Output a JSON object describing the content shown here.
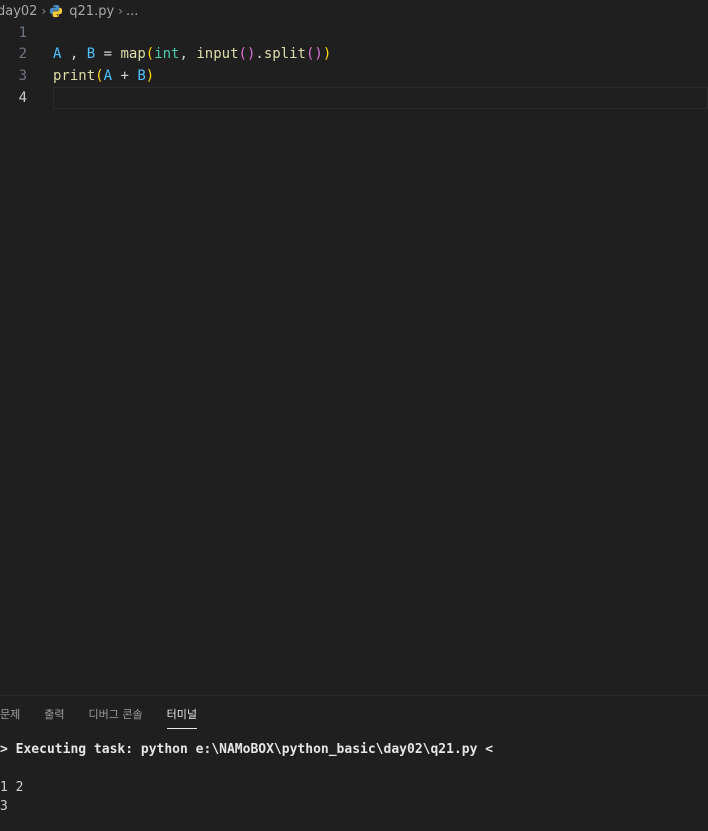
{
  "breadcrumb": {
    "folder": "day02",
    "file": "q21.py",
    "more": "..."
  },
  "editor": {
    "line_numbers": [
      "1",
      "2",
      "3",
      "4"
    ],
    "active_line": "4",
    "line2": {
      "t1": "A",
      "t2": " , ",
      "t3": "B",
      "t4": " = ",
      "t5": "map",
      "t6": "(",
      "t7": "int",
      "t8": ", ",
      "t9": "input",
      "t10": "()",
      "t11": ".",
      "t12": "split",
      "t13": "()",
      "t14": ")"
    },
    "line3": {
      "t1": "print",
      "t2": "(",
      "t3": "A",
      "t4": " + ",
      "t5": "B",
      "t6": ")"
    }
  },
  "panel": {
    "tabs": [
      "문제",
      "출력",
      "디버그 콘솔",
      "터미널"
    ],
    "active_tab": "터미널"
  },
  "terminal": {
    "task_line": "> Executing task: python e:\\NAMoBOX\\python_basic\\day02\\q21.py <",
    "blank": "",
    "input_line": "1 2",
    "output_line": "3"
  }
}
